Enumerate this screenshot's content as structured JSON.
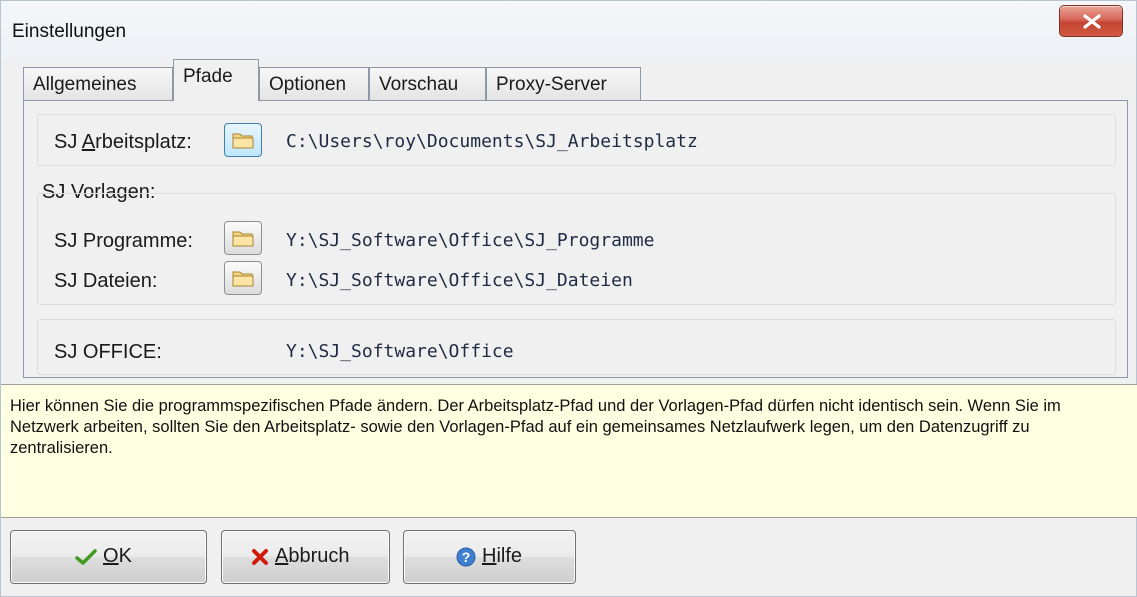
{
  "window": {
    "title": "Einstellungen"
  },
  "tabs": [
    {
      "label": "Allgemeines"
    },
    {
      "label": "Pfade",
      "active": true
    },
    {
      "label": "Optionen"
    },
    {
      "label": "Vorschau"
    },
    {
      "label": "Proxy-Server"
    }
  ],
  "paths": {
    "arbeitsplatz": {
      "label_prefix": "SJ ",
      "label_accel": "A",
      "label_rest": "rbeitsplatz:",
      "value": "C:\\Users\\roy\\Documents\\SJ_Arbeitsplatz"
    },
    "vorlagen_group_label": "SJ Vorlagen:",
    "programme": {
      "label": "SJ Programme:",
      "value": "Y:\\SJ_Software\\Office\\SJ_Programme"
    },
    "dateien": {
      "label": "SJ Dateien:",
      "value": "Y:\\SJ_Software\\Office\\SJ_Dateien"
    },
    "office": {
      "label": "SJ OFFICE:",
      "value": "Y:\\SJ_Software\\Office"
    }
  },
  "help_text": "Hier können Sie die programmspezifischen Pfade ändern. Der Arbeitsplatz-Pfad und der Vorlagen-Pfad dürfen nicht identisch sein. Wenn Sie im Netzwerk arbeiten, sollten Sie den Arbeitsplatz- sowie den Vorlagen-Pfad auf ein gemeinsames Netzlaufwerk legen, um den Datenzugriff zu zentralisieren.",
  "buttons": {
    "ok": {
      "accel": "O",
      "rest": "K",
      "icon": "checkmark-icon"
    },
    "abbruch": {
      "accel": "A",
      "rest": "bbruch",
      "icon": "red-x-icon"
    },
    "hilfe": {
      "accel": "H",
      "rest": "ilfe",
      "icon": "help-question-icon"
    }
  },
  "colors": {
    "help_background": "#ffffe1",
    "close_button": "#c9503d",
    "path_text": "#1f2a44"
  }
}
